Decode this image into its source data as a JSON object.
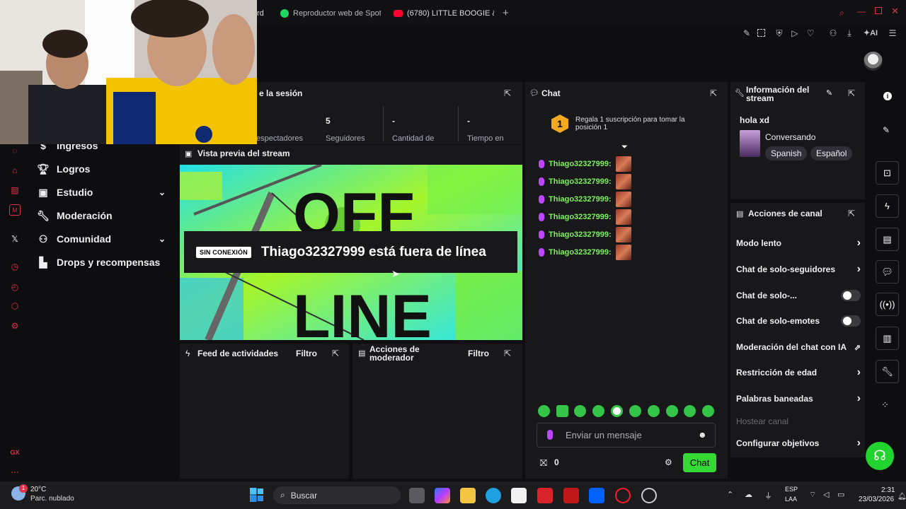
{
  "browser": {
    "tabs": [
      {
        "label": "rd"
      },
      {
        "label": "Reproductor web de Spoti"
      },
      {
        "label": "(6780) LITTLE BOOGIE & M"
      }
    ],
    "new_tab": "+",
    "ai_label": "AI"
  },
  "sidebar": {
    "items": [
      {
        "label": "Ingresos",
        "icon": "money-icon"
      },
      {
        "label": "Logros",
        "icon": "trophy-icon"
      },
      {
        "label": "Estudio",
        "icon": "studio-icon"
      },
      {
        "label": "Moderación",
        "icon": "wrench-icon"
      },
      {
        "label": "Comunidad",
        "icon": "community-icon"
      },
      {
        "label": "Drops y recompensas",
        "icon": "drops-icon"
      }
    ]
  },
  "session": {
    "title": "e la sesión",
    "stats": [
      {
        "value": "",
        "label": "espectadores"
      },
      {
        "value": "5",
        "label": "Seguidores"
      },
      {
        "value": "-",
        "label": "Cantidad de"
      },
      {
        "value": "-",
        "label": "Tiempo en"
      }
    ]
  },
  "preview": {
    "title": "Vista previa del stream",
    "badge": "SIN CONEXIÓN",
    "offline_text": "Thiago32327999 está fuera de línea",
    "graphic_top": "OFF",
    "graphic_bottom": "LINE"
  },
  "activity": {
    "title": "Feed de actividades",
    "filter": "Filtro"
  },
  "modactions": {
    "title": "Acciones de moderador",
    "filter": "Filtro"
  },
  "chat": {
    "title": "Chat",
    "gift_rank": "1",
    "gift_text": "Regala 1 suscripción para tomar la posición 1",
    "messages": [
      {
        "user": "Thiago32327999:"
      },
      {
        "user": "Thiago32327999:"
      },
      {
        "user": "Thiago32327999:"
      },
      {
        "user": "Thiago32327999:"
      },
      {
        "user": "Thiago32327999:"
      },
      {
        "user": "Thiago32327999:"
      }
    ],
    "input_placeholder": "Enviar un mensaje",
    "points": "0",
    "send_label": "Chat"
  },
  "stream_info": {
    "title": "Información del stream",
    "stream_title": "hola xd",
    "category": "Conversando",
    "tags": [
      "Spanish",
      "Español"
    ]
  },
  "channel_actions": {
    "title": "Acciones de canal",
    "items": [
      {
        "label": "Modo lento",
        "control": "chevron"
      },
      {
        "label": "Chat de solo-seguidores",
        "control": "chevron"
      },
      {
        "label": "Chat de solo-...",
        "control": "toggle"
      },
      {
        "label": "Chat de solo-emotes",
        "control": "toggle"
      },
      {
        "label": "Moderación del chat con IA",
        "control": "external"
      },
      {
        "label": "Restricción de edad",
        "control": "chevron"
      },
      {
        "label": "Palabras baneadas",
        "control": "chevron"
      },
      {
        "label": "Hostear canal",
        "control": "none"
      },
      {
        "label": "Configurar objetivos",
        "control": "chevron"
      }
    ]
  },
  "taskbar": {
    "weather_temp": "20°C",
    "weather_desc": "Parc. nublado",
    "weather_badge": "1",
    "search_placeholder": "Buscar",
    "lang_top": "ESP",
    "lang_bottom": "LAA",
    "time": "2:31",
    "date": "23/03/2026"
  },
  "rail_bottom": "GX",
  "colors": {
    "accent": "#34d934",
    "username": "#7cf25a",
    "brand_red": "#e0334a",
    "gift": "#f4a81d"
  }
}
